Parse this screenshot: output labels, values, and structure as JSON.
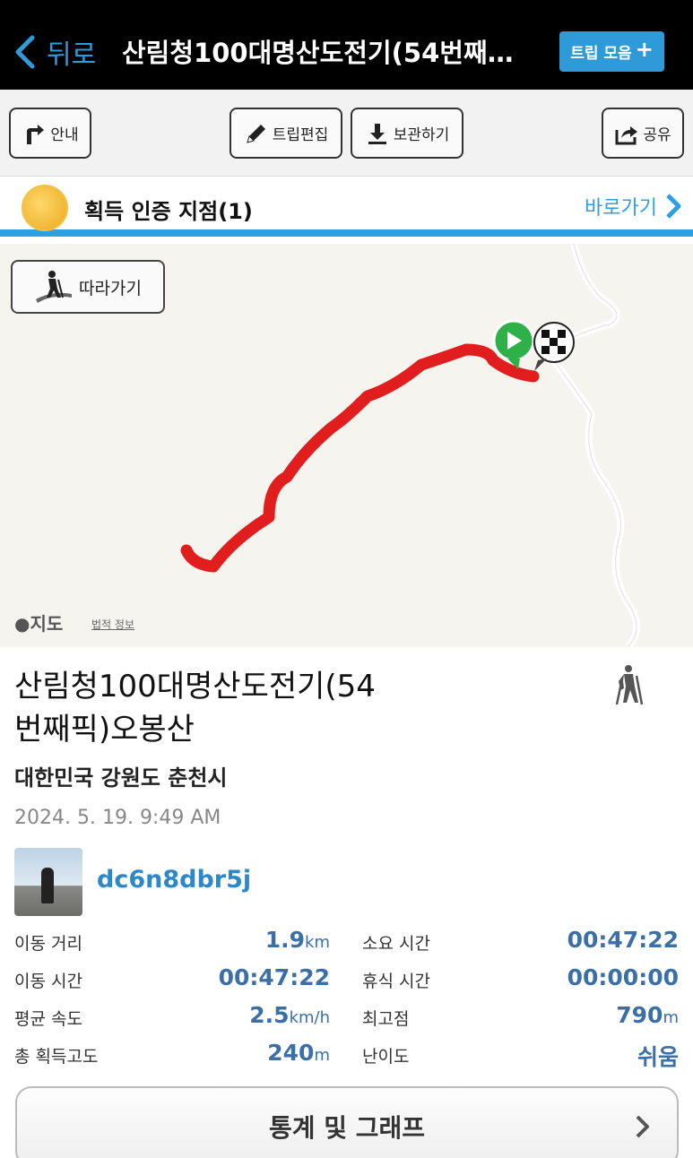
{
  "header": {
    "back_label": "뒤로",
    "title": "산림청100대명산도전기(54번째…",
    "trip_button_label": "트립 모음"
  },
  "toolbar": {
    "guide_label": "안내",
    "edit_label": "트립편집",
    "save_label": "보관하기",
    "share_label": "공유"
  },
  "badge": {
    "text": "획득 인증 지점(1)",
    "goto_label": "바로가기"
  },
  "map": {
    "follow_label": "따라가기",
    "maps_label": "지도",
    "legal_label": "법적 정보",
    "route_color": "#e21d1d"
  },
  "trip": {
    "title_line1": "산림청100대명산도전기(54",
    "title_line2": "번째픽)오봉산",
    "location": "대한민국 강원도 춘천시",
    "datetime": "2024. 5. 19. 9:49 AM",
    "username": "dc6n8dbr5j"
  },
  "stats": {
    "distance_label": "이동 거리",
    "distance_value": "1.9",
    "distance_unit": "km",
    "duration_label": "소요 시간",
    "duration_value": "00:47:22",
    "moving_time_label": "이동 시간",
    "moving_time_value": "00:47:22",
    "rest_time_label": "휴식 시간",
    "rest_time_value": "00:00:00",
    "avg_speed_label": "평균 속도",
    "avg_speed_value": "2.5",
    "avg_speed_unit": "km/h",
    "max_alt_label": "최고점",
    "max_alt_value": "790",
    "max_alt_unit": "m",
    "gain_label": "총 획득고도",
    "gain_value": "240",
    "gain_unit": "m",
    "difficulty_label": "난이도",
    "difficulty_value": "쉬움"
  },
  "graph_button_label": "통계 및 그래프",
  "colors": {
    "accent": "#2f9ad8",
    "stat_value": "#3a6fa8"
  }
}
